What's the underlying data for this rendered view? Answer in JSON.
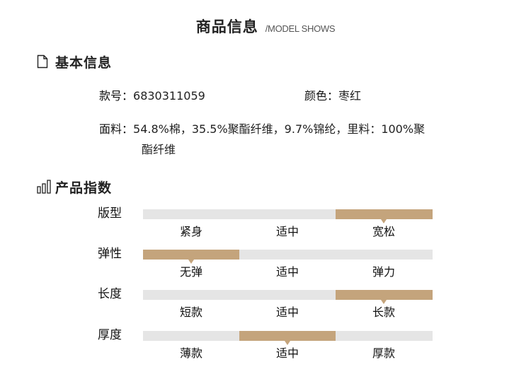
{
  "header": {
    "title": "商品信息",
    "subtitle": "/MODEL SHOWS"
  },
  "basic_info": {
    "heading": "基本信息",
    "icon": "document-icon",
    "style_no": {
      "key": "款号：",
      "value": "6830311059"
    },
    "color": {
      "key": "颜色：",
      "value": "枣红"
    },
    "fabric": {
      "key": "面料：",
      "value_line1": "54.8%棉，35.5%聚酯纤维，9.7%锦纶，里料：100%聚",
      "value_line2": "酯纤维"
    }
  },
  "product_index": {
    "heading": "产品指数",
    "icon": "bar-chart-icon",
    "accent_color": "#c4a47c",
    "track_color": "#e5e5e5",
    "scales": [
      {
        "label": "版型",
        "options": [
          "紧身",
          "适中",
          "宽松"
        ],
        "selected": 2
      },
      {
        "label": "弹性",
        "options": [
          "无弹",
          "适中",
          "弹力"
        ],
        "selected": 0
      },
      {
        "label": "长度",
        "options": [
          "短款",
          "适中",
          "长款"
        ],
        "selected": 2
      },
      {
        "label": "厚度",
        "options": [
          "薄款",
          "适中",
          "厚款"
        ],
        "selected": 1
      }
    ]
  }
}
